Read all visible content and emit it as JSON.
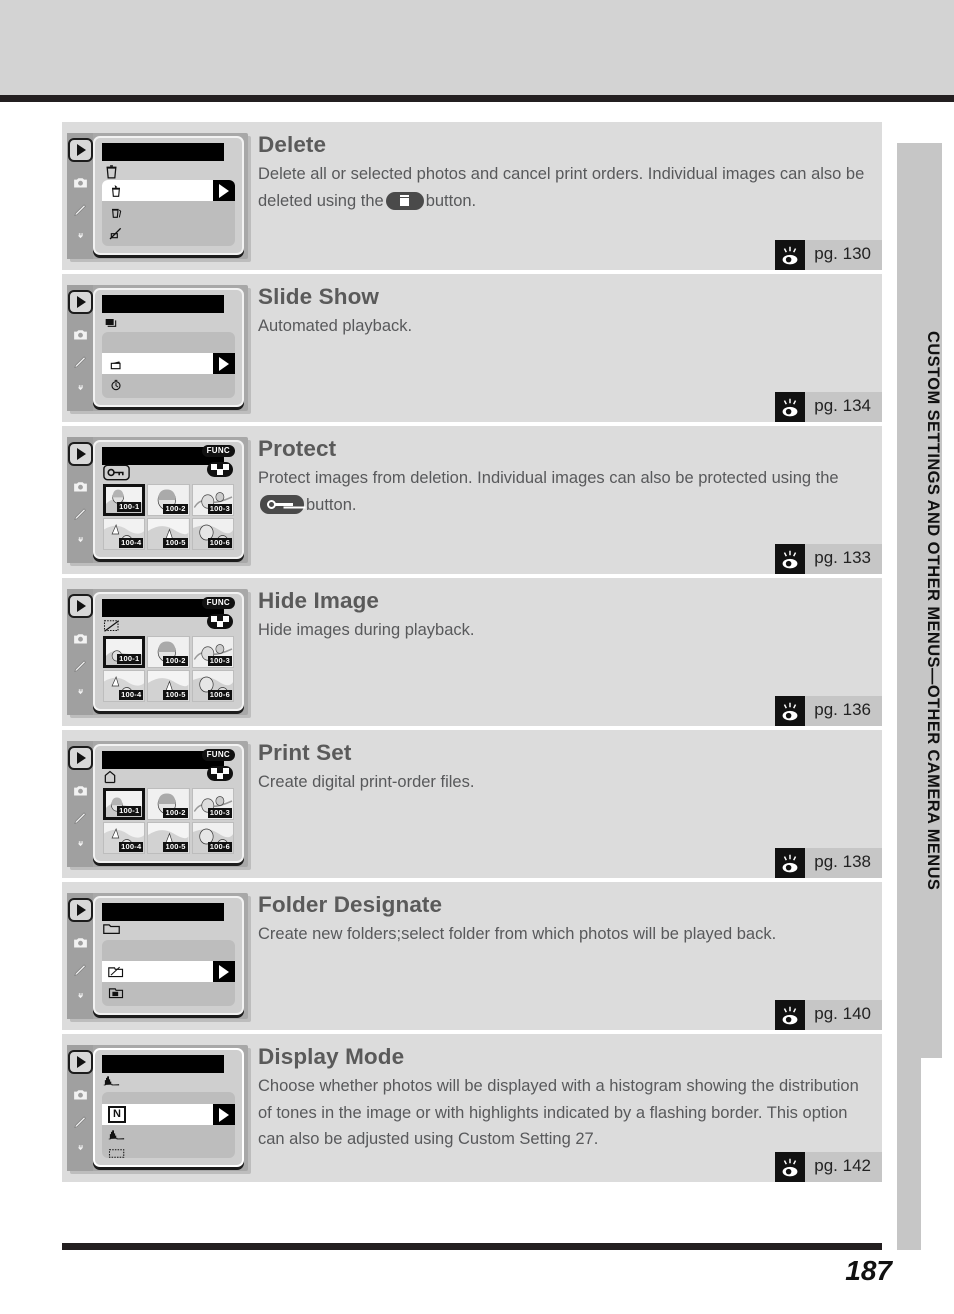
{
  "running_head": "CUSTOM SETTINGS AND OTHER MENUS—OTHER CAMERA MENUS",
  "page_number": "187",
  "colors": {
    "row_bg": "#dcdcdc",
    "chip_bg": "#c6c6c6",
    "title_text": "#5a5a5a",
    "body_text": "#58595b",
    "rule": "#231f20"
  },
  "pg_prefix": "pg.",
  "icons": {
    "play": "play-icon",
    "camera": "camera-icon",
    "pencil": "pencil-icon",
    "wrench": "wrench-icon",
    "func": "FUNC",
    "trash": "trash-icon",
    "key": "key-icon",
    "eye": "eye-icon"
  },
  "thumb_labels": [
    "100-1",
    "100-2",
    "100-3",
    "100-4",
    "100-5",
    "100-6"
  ],
  "items": [
    {
      "id": "delete",
      "title": "Delete",
      "desc_before": "Delete all or selected photos and cancel print orders.  Individual images can also be deleted using the",
      "inline_button": "trash-button",
      "desc_after": "button.",
      "page_ref": "130",
      "lcd_type": "list",
      "lcd_subicon": "trash-icon",
      "options": [
        "delete-selected",
        "delete-all",
        "delete-print-set"
      ],
      "selected_index": 0
    },
    {
      "id": "slide-show",
      "title": "Slide Show",
      "desc_before": "Automated playback.",
      "inline_button": "",
      "desc_after": "",
      "page_ref": "134",
      "lcd_type": "list",
      "lcd_subicon": "slides-icon",
      "options": [
        "start-slideshow",
        "frame-interval"
      ],
      "selected_index": 0
    },
    {
      "id": "protect",
      "title": "Protect",
      "desc_before": "Protect images from deletion.  Individual images can also be protected using the",
      "inline_button": "key-button",
      "desc_after": "button.",
      "page_ref": "133",
      "lcd_type": "thumbs",
      "lcd_subicon": "key-icon",
      "badge_func": "FUNC",
      "thumb_mark": "key-mark"
    },
    {
      "id": "hide-image",
      "title": "Hide Image",
      "desc_before": "Hide images during playback.",
      "inline_button": "",
      "desc_after": "",
      "page_ref": "136",
      "lcd_type": "thumbs",
      "lcd_subicon": "hide-icon",
      "badge_func": "FUNC",
      "thumb_mark": "hide-mark"
    },
    {
      "id": "print-set",
      "title": "Print Set",
      "desc_before": "Create digital print-order files.",
      "inline_button": "",
      "desc_after": "",
      "page_ref": "138",
      "lcd_type": "thumbs",
      "lcd_subicon": "printer-icon",
      "badge_func": "FUNC",
      "thumb_mark": "print-mark"
    },
    {
      "id": "folder-designate",
      "title": "Folder Designate",
      "desc_before": "Create new folders;select folder from which photos will be played back.",
      "inline_button": "",
      "desc_after": "",
      "page_ref": "140",
      "lcd_type": "list",
      "lcd_subicon": "folder-icon",
      "options": [
        "new-folder",
        "select-folder"
      ],
      "selected_index": 0
    },
    {
      "id": "display-mode",
      "title": "Display Mode",
      "desc_before": "Choose whether photos will be displayed with a histogram showing the distribution of tones in the image or with highlights indicated by a flashing border.  This option can also be adjusted using Custom Setting 27.",
      "inline_button": "",
      "desc_after": "",
      "page_ref": "142",
      "lcd_type": "list-n",
      "lcd_subicon": "histogram-icon",
      "options": [
        "N",
        "histogram",
        "highlights",
        "histogram-and-highlights"
      ],
      "selected_index": 0
    }
  ]
}
